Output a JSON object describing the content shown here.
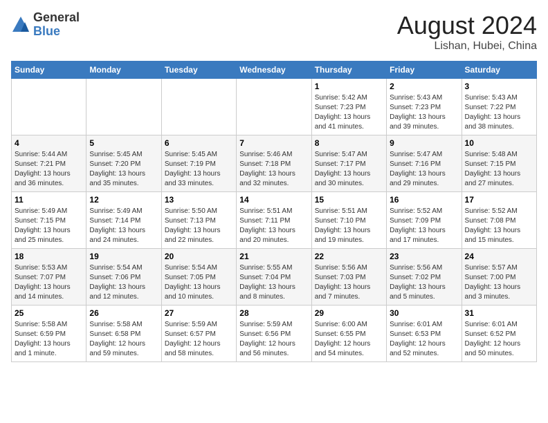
{
  "header": {
    "logo_general": "General",
    "logo_blue": "Blue",
    "month_title": "August 2024",
    "location": "Lishan, Hubei, China"
  },
  "weekdays": [
    "Sunday",
    "Monday",
    "Tuesday",
    "Wednesday",
    "Thursday",
    "Friday",
    "Saturday"
  ],
  "weeks": [
    [
      {
        "day": "",
        "info": ""
      },
      {
        "day": "",
        "info": ""
      },
      {
        "day": "",
        "info": ""
      },
      {
        "day": "",
        "info": ""
      },
      {
        "day": "1",
        "info": "Sunrise: 5:42 AM\nSunset: 7:23 PM\nDaylight: 13 hours\nand 41 minutes."
      },
      {
        "day": "2",
        "info": "Sunrise: 5:43 AM\nSunset: 7:23 PM\nDaylight: 13 hours\nand 39 minutes."
      },
      {
        "day": "3",
        "info": "Sunrise: 5:43 AM\nSunset: 7:22 PM\nDaylight: 13 hours\nand 38 minutes."
      }
    ],
    [
      {
        "day": "4",
        "info": "Sunrise: 5:44 AM\nSunset: 7:21 PM\nDaylight: 13 hours\nand 36 minutes."
      },
      {
        "day": "5",
        "info": "Sunrise: 5:45 AM\nSunset: 7:20 PM\nDaylight: 13 hours\nand 35 minutes."
      },
      {
        "day": "6",
        "info": "Sunrise: 5:45 AM\nSunset: 7:19 PM\nDaylight: 13 hours\nand 33 minutes."
      },
      {
        "day": "7",
        "info": "Sunrise: 5:46 AM\nSunset: 7:18 PM\nDaylight: 13 hours\nand 32 minutes."
      },
      {
        "day": "8",
        "info": "Sunrise: 5:47 AM\nSunset: 7:17 PM\nDaylight: 13 hours\nand 30 minutes."
      },
      {
        "day": "9",
        "info": "Sunrise: 5:47 AM\nSunset: 7:16 PM\nDaylight: 13 hours\nand 29 minutes."
      },
      {
        "day": "10",
        "info": "Sunrise: 5:48 AM\nSunset: 7:15 PM\nDaylight: 13 hours\nand 27 minutes."
      }
    ],
    [
      {
        "day": "11",
        "info": "Sunrise: 5:49 AM\nSunset: 7:15 PM\nDaylight: 13 hours\nand 25 minutes."
      },
      {
        "day": "12",
        "info": "Sunrise: 5:49 AM\nSunset: 7:14 PM\nDaylight: 13 hours\nand 24 minutes."
      },
      {
        "day": "13",
        "info": "Sunrise: 5:50 AM\nSunset: 7:13 PM\nDaylight: 13 hours\nand 22 minutes."
      },
      {
        "day": "14",
        "info": "Sunrise: 5:51 AM\nSunset: 7:11 PM\nDaylight: 13 hours\nand 20 minutes."
      },
      {
        "day": "15",
        "info": "Sunrise: 5:51 AM\nSunset: 7:10 PM\nDaylight: 13 hours\nand 19 minutes."
      },
      {
        "day": "16",
        "info": "Sunrise: 5:52 AM\nSunset: 7:09 PM\nDaylight: 13 hours\nand 17 minutes."
      },
      {
        "day": "17",
        "info": "Sunrise: 5:52 AM\nSunset: 7:08 PM\nDaylight: 13 hours\nand 15 minutes."
      }
    ],
    [
      {
        "day": "18",
        "info": "Sunrise: 5:53 AM\nSunset: 7:07 PM\nDaylight: 13 hours\nand 14 minutes."
      },
      {
        "day": "19",
        "info": "Sunrise: 5:54 AM\nSunset: 7:06 PM\nDaylight: 13 hours\nand 12 minutes."
      },
      {
        "day": "20",
        "info": "Sunrise: 5:54 AM\nSunset: 7:05 PM\nDaylight: 13 hours\nand 10 minutes."
      },
      {
        "day": "21",
        "info": "Sunrise: 5:55 AM\nSunset: 7:04 PM\nDaylight: 13 hours\nand 8 minutes."
      },
      {
        "day": "22",
        "info": "Sunrise: 5:56 AM\nSunset: 7:03 PM\nDaylight: 13 hours\nand 7 minutes."
      },
      {
        "day": "23",
        "info": "Sunrise: 5:56 AM\nSunset: 7:02 PM\nDaylight: 13 hours\nand 5 minutes."
      },
      {
        "day": "24",
        "info": "Sunrise: 5:57 AM\nSunset: 7:00 PM\nDaylight: 13 hours\nand 3 minutes."
      }
    ],
    [
      {
        "day": "25",
        "info": "Sunrise: 5:58 AM\nSunset: 6:59 PM\nDaylight: 13 hours\nand 1 minute."
      },
      {
        "day": "26",
        "info": "Sunrise: 5:58 AM\nSunset: 6:58 PM\nDaylight: 12 hours\nand 59 minutes."
      },
      {
        "day": "27",
        "info": "Sunrise: 5:59 AM\nSunset: 6:57 PM\nDaylight: 12 hours\nand 58 minutes."
      },
      {
        "day": "28",
        "info": "Sunrise: 5:59 AM\nSunset: 6:56 PM\nDaylight: 12 hours\nand 56 minutes."
      },
      {
        "day": "29",
        "info": "Sunrise: 6:00 AM\nSunset: 6:55 PM\nDaylight: 12 hours\nand 54 minutes."
      },
      {
        "day": "30",
        "info": "Sunrise: 6:01 AM\nSunset: 6:53 PM\nDaylight: 12 hours\nand 52 minutes."
      },
      {
        "day": "31",
        "info": "Sunrise: 6:01 AM\nSunset: 6:52 PM\nDaylight: 12 hours\nand 50 minutes."
      }
    ]
  ]
}
